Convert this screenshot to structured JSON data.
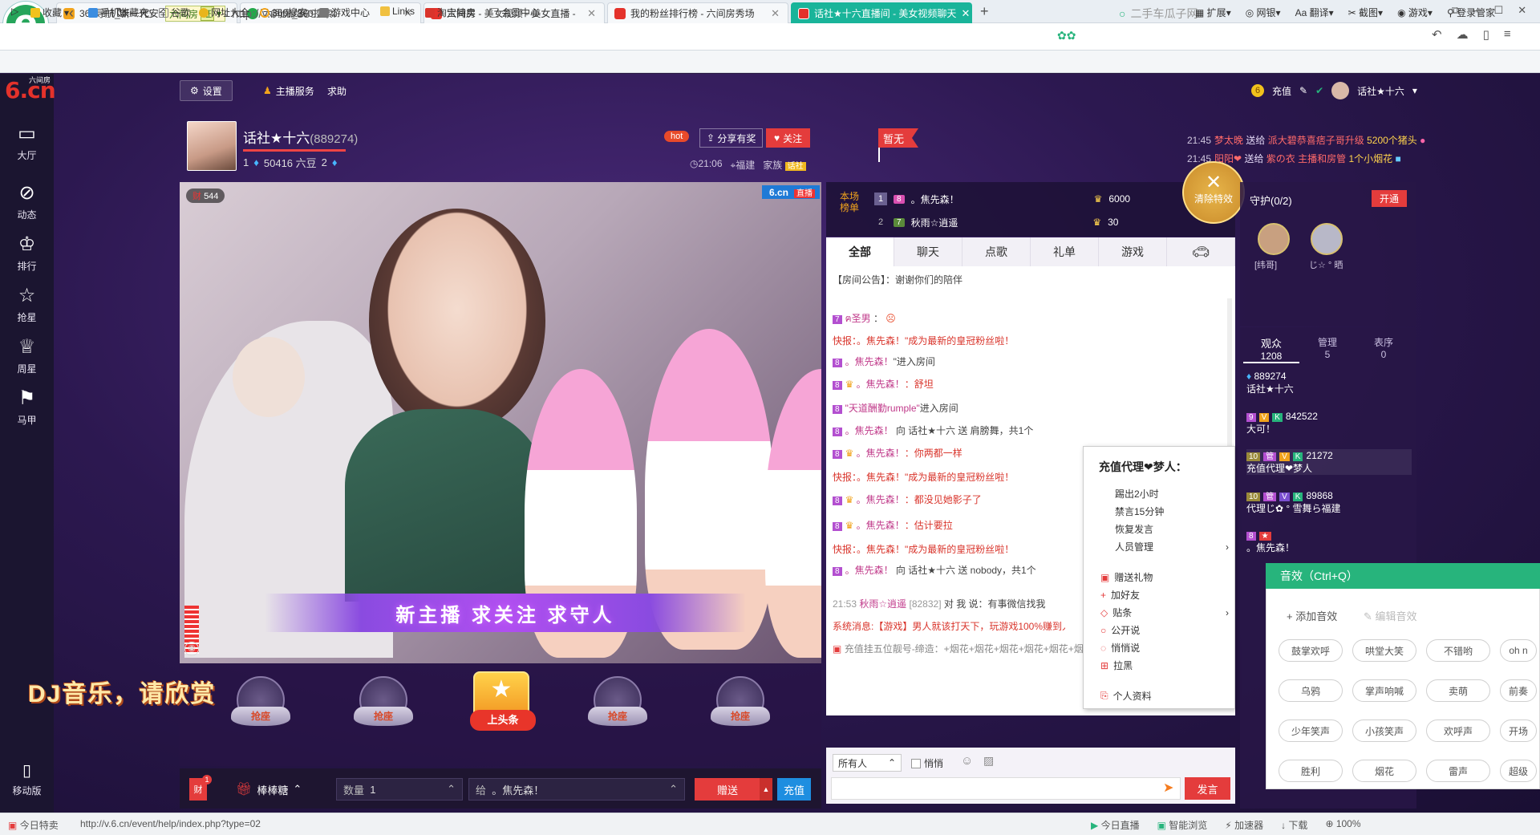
{
  "browser": {
    "tabs": [
      {
        "label": "360导航_新一代安全上网导航",
        "color": "#f1a31c"
      },
      {
        "label": "六间房_360搜索",
        "color": "#23a84a"
      },
      {
        "label": "六间房 - 美女视频 - 美女直播 - ",
        "color": "#e4322b"
      },
      {
        "label": "我的粉丝排行榜 - 六间房秀场",
        "color": "#e4322b"
      },
      {
        "label": "话社★十六直播间 - 美女视频聊天",
        "color": "#e4322b",
        "active": true
      }
    ],
    "site_badge": "六间房",
    "cert": "证",
    "url": "http://v.6.cn/889274",
    "search_placeholder": "二手车瓜子网",
    "bookmarks": [
      "收藏",
      "手机收藏夹",
      "谷歌",
      "网址大全",
      "360搜索",
      "游戏中心",
      "Links",
      "淘宝特卖",
      "会员中心"
    ],
    "tools": [
      "扩展",
      "网银",
      "翻译",
      "截图",
      "游戏",
      "登录管家"
    ],
    "status_url": "http://v.6.cn/event/help/index.php?type=02",
    "status_left": "今日特卖",
    "status_items": [
      "今日直播",
      "智能浏览",
      "加速器",
      "下载",
      "100%"
    ]
  },
  "site": {
    "brand_small": "六间房",
    "brand": "6.cn",
    "left_nav": [
      "大厅",
      "动态",
      "排行",
      "抢星",
      "周星",
      "马甲"
    ],
    "mobile_label": "移动版",
    "top_nav": {
      "settings": "设置",
      "anchor_service": "主播服务",
      "help": "求助"
    },
    "user": {
      "recharge": "充值",
      "name": "话社★十六"
    }
  },
  "anchor": {
    "name": "话社★十六",
    "room_id": "(889274)",
    "beans": "50416 六豆",
    "level_a": "1",
    "level_b": "2",
    "hot": "hot",
    "share": "分享有奖",
    "follow": "关注",
    "time": "21:06",
    "location": "福建",
    "family": "家族",
    "family_tag": "话社",
    "flag": "暂无"
  },
  "top_gifts": [
    {
      "time": "21:45",
      "user": "梦太晚",
      "verb": "送给",
      "target": "派大碧恭喜痞子哥升级",
      "gift": "5200个猪头"
    },
    {
      "time": "21:45",
      "user": "阳阳❤",
      "verb": "送给",
      "target": "紫の衣 主播和房管",
      "gift": "1个小烟花"
    }
  ],
  "video": {
    "viewer_badge": "544",
    "logo": "6.cn",
    "live": "直播",
    "banner": "新主播  求关注  求守人"
  },
  "overlay_text": "DJ音乐，请欣赏",
  "seats": [
    "抢座",
    "抢座",
    "上头条",
    "抢座",
    "抢座"
  ],
  "giftbar": {
    "gift_name": "棒棒糖",
    "qty_label": "数量",
    "qty_value": "1",
    "to_label": "给",
    "to_value": "。焦先森！",
    "give": "赠送",
    "charge": "充值",
    "badge": "1"
  },
  "rank": {
    "title": "本场榜单",
    "rows": [
      {
        "n": "1",
        "name": "。焦先森！",
        "score": "6000"
      },
      {
        "n": "2",
        "name": "秋雨☆逍遥",
        "score": "30"
      }
    ],
    "clear_fx": "清除特效"
  },
  "chat_tabs": [
    "全部",
    "聊天",
    "点歌",
    "礼单",
    "游戏"
  ],
  "chat": {
    "notice_label": "【房间公告】",
    "notice": "谢谢你们的陪伴",
    "messages": [
      {
        "user": "ฅ圣男",
        "text": "："
      },
      {
        "sys": "快报：",
        "text": "。焦先森！\"成为最新的皇冠粉丝啦！"
      },
      {
        "user": "。焦先森！",
        "text": "\"进入房间"
      },
      {
        "user": "。焦先森！",
        "text": "：舒坦"
      },
      {
        "user": "\"天道酬勤rumple\"",
        "text": "进入房间"
      },
      {
        "user": "。焦先森！",
        "text": "向 话社★十六 送 肩膀舞，共1个"
      },
      {
        "user": "。焦先森！",
        "text": "：你两都一样"
      },
      {
        "sys": "快报：",
        "text": "。焦先森！\"成为最新的皇冠粉丝啦！"
      },
      {
        "user": "。焦先森！",
        "text": "：都没见她影子了"
      },
      {
        "user": "。焦先森！",
        "text": "：估计要拉"
      },
      {
        "sys": "快报：",
        "text": "。焦先森！\"成为最新的皇冠粉丝啦！"
      },
      {
        "user": "。焦先森！",
        "text": "向 话社★十六 送 nobody，共1个"
      }
    ],
    "private_time": "21:53",
    "private_user": "秋雨☆逍遥",
    "private_id": "[82832]",
    "private_text": "对 我 说：有事微信找我",
    "system_msg": "系统消息:【游戏】男人就该打天下，玩游戏100%赚到人民币",
    "marquee": "充值挂五位靓号-缔造：+烟花+烟花+烟花+烟花+烟花+烟花+烟花+烟花+烟花+烟花+烟花+烟花"
  },
  "chat_input": {
    "target": "所有人",
    "whisper": "悄悄",
    "send": "发言"
  },
  "context_menu": {
    "title": "充值代理❤梦人：",
    "items": [
      "踢出2小时",
      "禁言15分钟",
      "恢复发言",
      "人员管理",
      "赠送礼物",
      "加好友",
      "贴条",
      "公开说",
      "悄悄说",
      "拉黑",
      "个人资料"
    ]
  },
  "guard": {
    "title": "守护(0/2)",
    "open": "开通",
    "members": [
      "[纬哥]",
      "じ☆ ° 晒"
    ]
  },
  "audience": {
    "tabs": [
      {
        "label": "观众",
        "count": "1208"
      },
      {
        "label": "管理",
        "count": "5"
      },
      {
        "label": "表序",
        "count": "0"
      }
    ],
    "rows": [
      {
        "id": "889274",
        "name": "话社★十六"
      },
      {
        "id": "842522",
        "name": "大可！"
      },
      {
        "id": "21272",
        "name": "充值代理❤梦人"
      },
      {
        "id": "89868",
        "name": "代理じ✿ ° 雪舞ら福建"
      },
      {
        "id": "",
        "name": "。焦先森！"
      }
    ]
  },
  "sound": {
    "title": "音效（Ctrl+Q）",
    "add": "添加音效",
    "edit": "编辑音效",
    "buttons": [
      "鼓掌欢呼",
      "哄堂大笑",
      "不错哟",
      "oh n",
      "乌鸦",
      "掌声响喊",
      "卖萌",
      "前奏",
      "少年笑声",
      "小孩笑声",
      "欢呼声",
      "开场",
      "胜利",
      "烟花",
      "雷声",
      "超级"
    ]
  }
}
